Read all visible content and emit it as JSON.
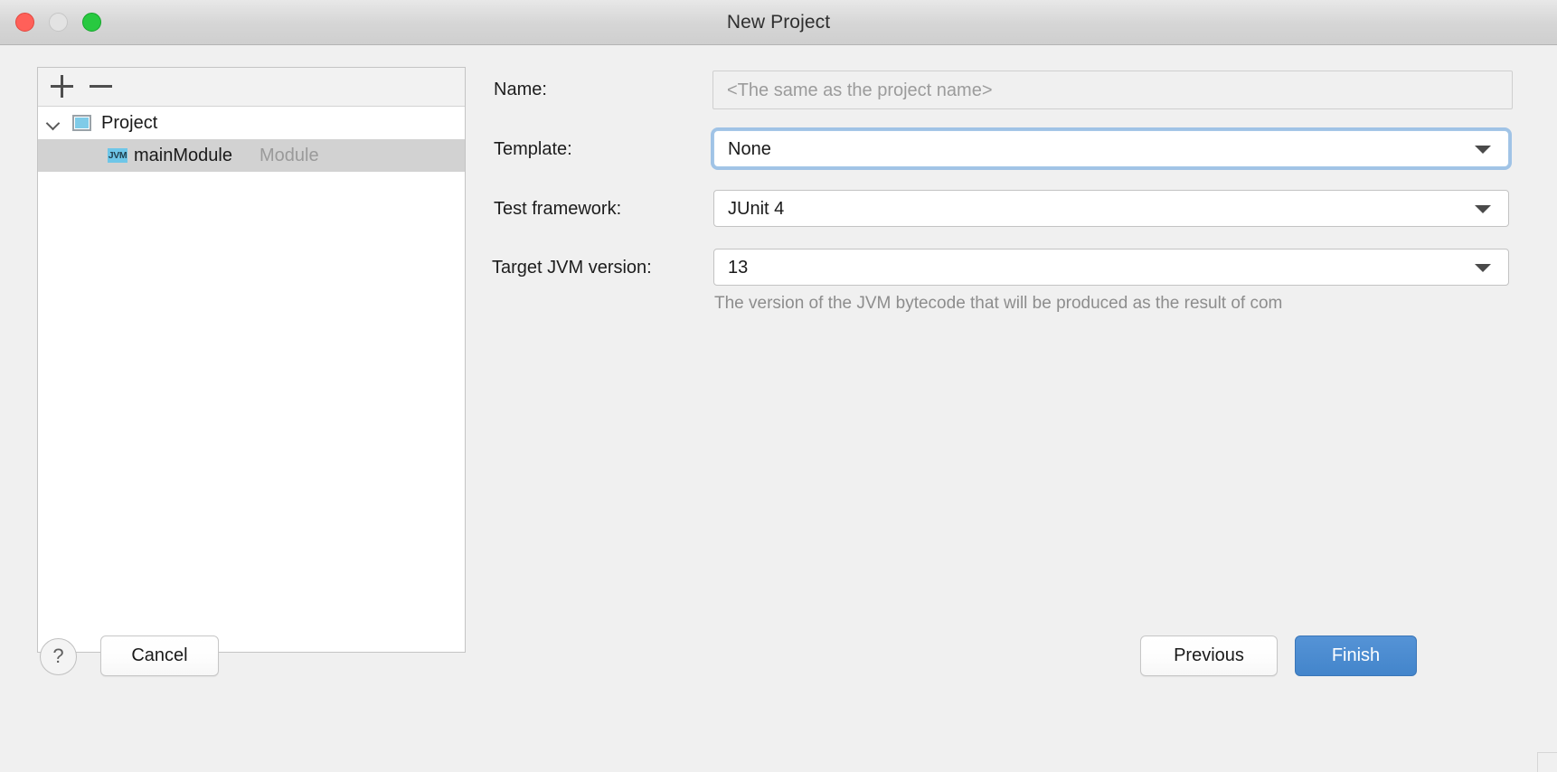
{
  "window": {
    "title": "New Project",
    "controls": {
      "close": "close-button",
      "minimize": "minimize-button",
      "maximize": "maximize-button"
    }
  },
  "tree_panel": {
    "toolbar": {
      "add_label": "+",
      "remove_label": "−"
    },
    "nodes": [
      {
        "label": "Project",
        "icon": "project-icon",
        "expanded": true,
        "selected": false
      },
      {
        "label": "mainModule",
        "type_label": "Module",
        "icon": "jvm-icon",
        "icon_text": "JVM",
        "selected": true
      }
    ]
  },
  "form": {
    "name": {
      "label": "Name:",
      "value": "",
      "placeholder": "<The same as the project name>"
    },
    "template": {
      "label": "Template:",
      "value": "None",
      "focused": true
    },
    "test_framework": {
      "label": "Test framework:",
      "value": "JUnit 4"
    },
    "target_jvm_version": {
      "label": "Target JVM version:",
      "value": "13",
      "help": "The version of the JVM bytecode that will be produced as the result of com"
    }
  },
  "footer": {
    "help_label": "?",
    "cancel_label": "Cancel",
    "previous_label": "Previous",
    "finish_label": "Finish"
  },
  "colors": {
    "accent": "#4385cb",
    "focus_ring": "#74aae0",
    "selection": "#d2d2d2",
    "window_bg": "#f0f0f0",
    "close": "#ff6059",
    "maximize": "#28c940"
  }
}
